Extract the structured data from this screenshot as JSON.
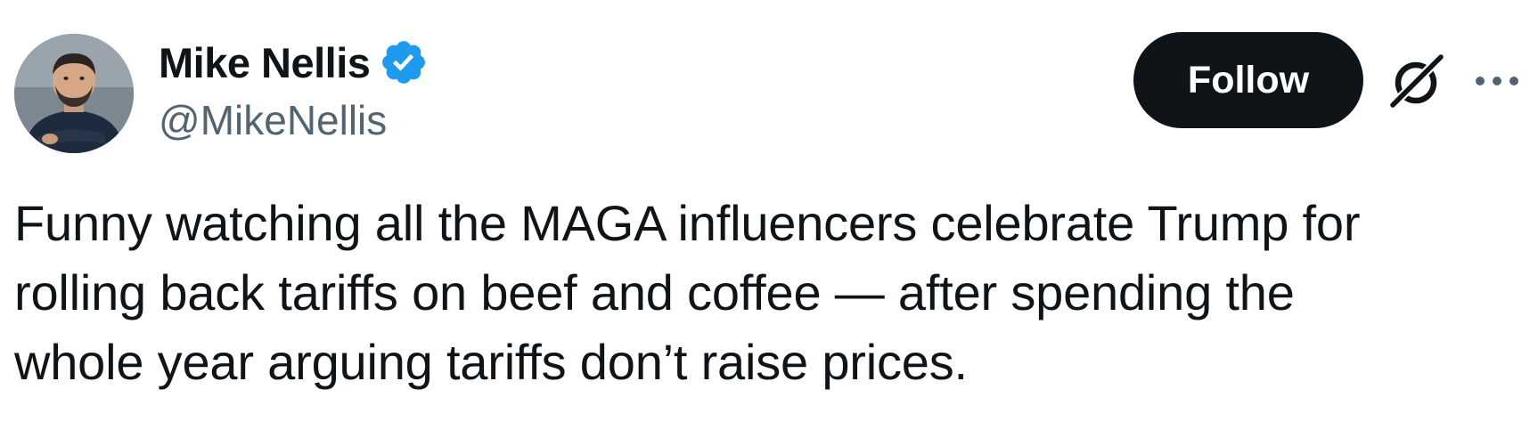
{
  "author": {
    "display_name": "Mike Nellis",
    "handle": "@MikeNellis",
    "verified": true,
    "avatar_icon": "avatar-photo"
  },
  "actions": {
    "follow_label": "Follow",
    "grok_icon": "grok-icon",
    "more_icon": "more-icon"
  },
  "tweet": {
    "text": "Funny watching all the MAGA influencers celebrate Trump for\nrolling back tariffs on beef and coffee — after spending the\nwhole year arguing tariffs don’t raise prices."
  },
  "colors": {
    "verified_badge": "#1d9bf0",
    "follow_bg": "#0f1419",
    "handle": "#536471",
    "text": "#0f1419"
  }
}
